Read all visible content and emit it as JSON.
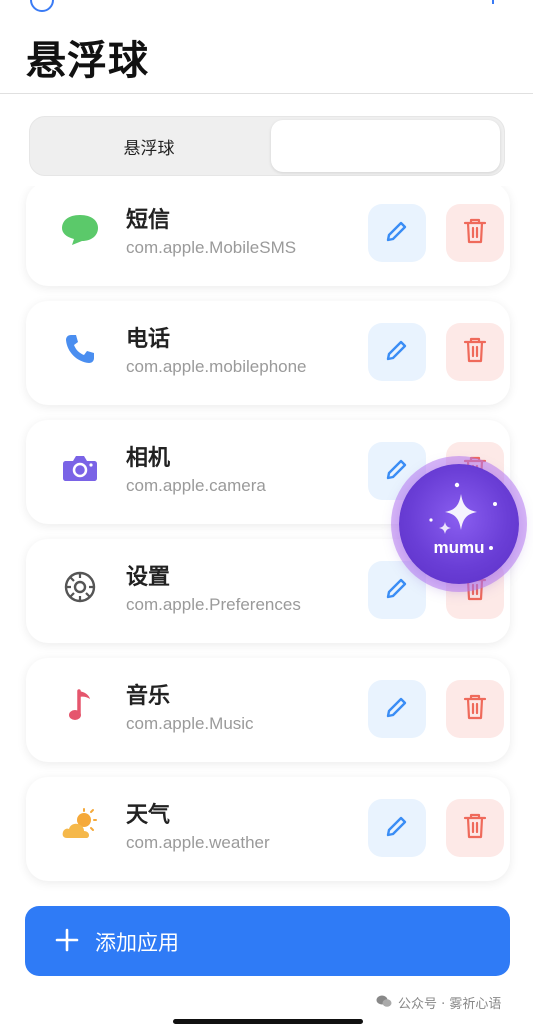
{
  "page": {
    "title": "悬浮球"
  },
  "segmented": {
    "tabs": [
      {
        "label": "悬浮球"
      },
      {
        "label": ""
      }
    ]
  },
  "apps": [
    {
      "name": "短信",
      "bundle_id": "com.apple.MobileSMS",
      "icon": "message-bubble-icon",
      "icon_color": "#5bc96a"
    },
    {
      "name": "电话",
      "bundle_id": "com.apple.mobilephone",
      "icon": "phone-icon",
      "icon_color": "#4a8ef0"
    },
    {
      "name": "相机",
      "bundle_id": "com.apple.camera",
      "icon": "camera-icon",
      "icon_color": "#7a63e6"
    },
    {
      "name": "设置",
      "bundle_id": "com.apple.Preferences",
      "icon": "gear-icon",
      "icon_color": "#555555"
    },
    {
      "name": "音乐",
      "bundle_id": "com.apple.Music",
      "icon": "music-note-icon",
      "icon_color": "#e5566d"
    },
    {
      "name": "天气",
      "bundle_id": "com.apple.weather",
      "icon": "sun-cloud-icon",
      "icon_color": "#f5a93a"
    }
  ],
  "row_actions": {
    "edit_icon": "pencil-icon",
    "delete_icon": "trash-icon",
    "edit_color": "#3a8df5",
    "delete_color": "#ef6a5b"
  },
  "floating_ball": {
    "label": "mumu",
    "icon": "sparkle-icon"
  },
  "add_button": {
    "label": "添加应用",
    "icon": "plus-icon",
    "color": "#2f7bf6"
  },
  "watermark": {
    "text": "公众号 · 雾祈心语",
    "icon": "wechat-icon"
  }
}
